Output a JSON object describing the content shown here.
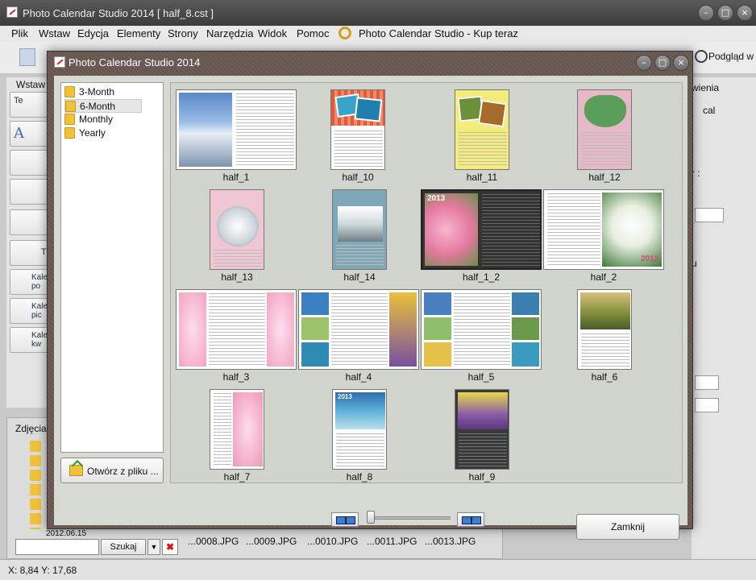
{
  "window": {
    "title": "Photo Calendar Studio 2014 [ half_8.cst ]"
  },
  "menu": [
    "Plik",
    "Wstaw",
    "Edycja",
    "Elementy",
    "Strony",
    "Narzędzia",
    "Widok",
    "Pomoc",
    "Photo Calendar Studio - Kup teraz"
  ],
  "toolbar": {
    "preview_label": "Podgląd w"
  },
  "left_panel": {
    "tab": "Wstaw",
    "buttons": [
      "Te",
      "A",
      "",
      "",
      "",
      "T",
      "Kale po",
      "Kale pic",
      "Kale kw"
    ]
  },
  "right_panel": {
    "tab": "wienia",
    "radio_label": "cal",
    "field_label": "r :",
    "field_label2": "u"
  },
  "photos_panel": {
    "tab": "Zdjęcia",
    "date_item": "2012.06.15",
    "search_button": "Szukaj",
    "files": [
      "...0008.JPG",
      "...0009.JPG",
      "...0010.JPG",
      "...0011.JPG",
      "...0013.JPG"
    ]
  },
  "status": {
    "coords": "X: 8,84 Y: 17,68"
  },
  "dialog": {
    "title": "Photo Calendar Studio 2014",
    "folders": [
      {
        "label": "3-Month",
        "selected": false
      },
      {
        "label": "6-Month",
        "selected": true
      },
      {
        "label": "Monthly",
        "selected": false
      },
      {
        "label": "Yearly",
        "selected": false
      }
    ],
    "open_button": "Otwórz z pliku ...",
    "close_button": "Zamknij",
    "year_text": "2013",
    "templates": [
      "half_1",
      "half_10",
      "half_11",
      "half_12",
      "half_13",
      "half_14",
      "half_1_2",
      "half_2",
      "half_3",
      "half_4",
      "half_5",
      "half_6",
      "half_7",
      "half_8",
      "half_9"
    ],
    "selected_template": "half_1_2"
  },
  "colors": {
    "dialog_frame": "#6b5b53",
    "gallery_bg": "#d0d2cc",
    "title_bar": "#4a4a4a"
  }
}
